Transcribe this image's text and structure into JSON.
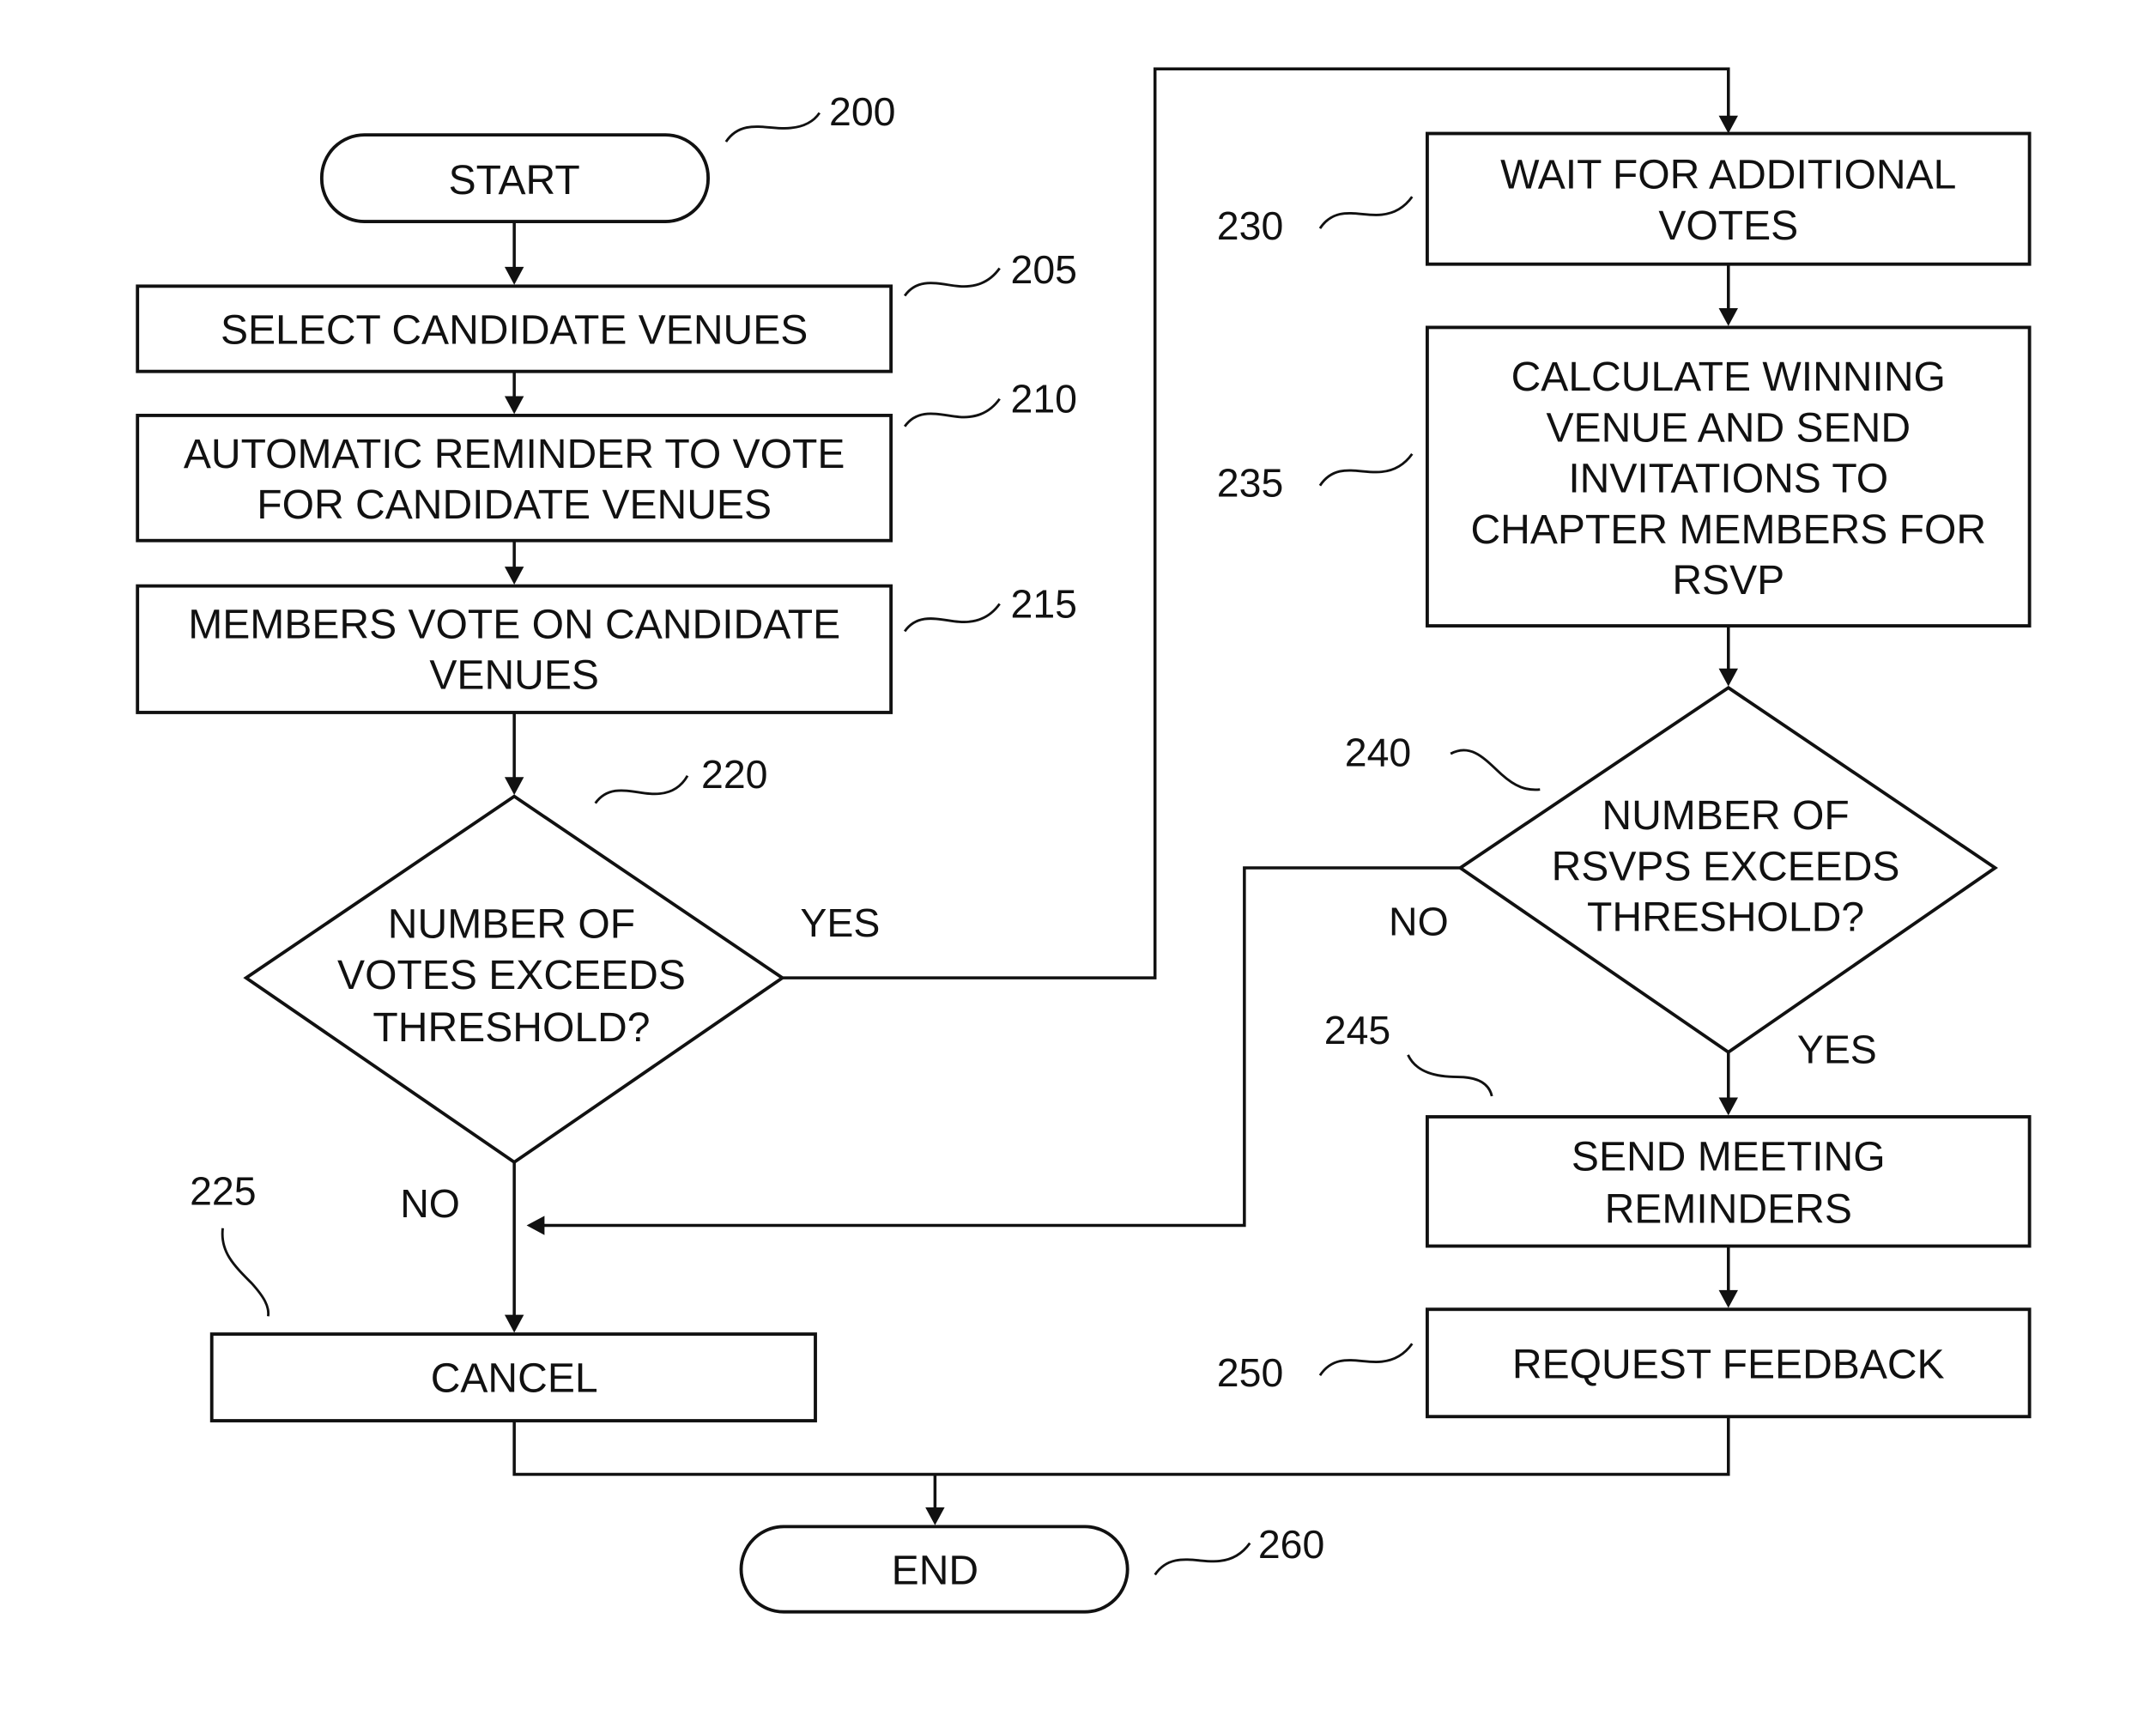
{
  "figure": {
    "figure_ref": "200",
    "nodes": [
      {
        "id": "start",
        "ref": "",
        "type": "terminal",
        "lines": [
          "START"
        ]
      },
      {
        "id": "select-candidate-venues",
        "ref": "205",
        "type": "process",
        "lines": [
          "SELECT CANDIDATE VENUES"
        ]
      },
      {
        "id": "automatic-reminder",
        "ref": "210",
        "type": "process",
        "lines": [
          "AUTOMATIC REMINDER TO VOTE",
          "FOR CANDIDATE VENUES"
        ]
      },
      {
        "id": "members-vote",
        "ref": "215",
        "type": "process",
        "lines": [
          "MEMBERS VOTE ON CANDIDATE",
          "VENUES"
        ]
      },
      {
        "id": "votes-threshold",
        "ref": "220",
        "type": "decision",
        "lines": [
          "NUMBER OF",
          "VOTES EXCEEDS",
          "THRESHOLD?"
        ]
      },
      {
        "id": "cancel",
        "ref": "225",
        "type": "process",
        "lines": [
          "CANCEL"
        ]
      },
      {
        "id": "wait-additional-votes",
        "ref": "230",
        "type": "process",
        "lines": [
          "WAIT FOR ADDITIONAL",
          "VOTES"
        ]
      },
      {
        "id": "calculate-winning-venue",
        "ref": "235",
        "type": "process",
        "lines": [
          "CALCULATE WINNING",
          "VENUE AND SEND",
          "INVITATIONS TO",
          "CHAPTER MEMBERS FOR",
          "RSVP"
        ]
      },
      {
        "id": "rsvps-threshold",
        "ref": "240",
        "type": "decision",
        "lines": [
          "NUMBER OF",
          "RSVPS EXCEEDS",
          "THRESHOLD?"
        ]
      },
      {
        "id": "send-meeting-reminders",
        "ref": "245",
        "type": "process",
        "lines": [
          "SEND MEETING",
          "REMINDERS"
        ]
      },
      {
        "id": "request-feedback",
        "ref": "250",
        "type": "process",
        "lines": [
          "REQUEST FEEDBACK"
        ]
      },
      {
        "id": "end",
        "ref": "260",
        "type": "terminal",
        "lines": [
          "END"
        ]
      }
    ],
    "edge_labels": {
      "votes_yes": "YES",
      "votes_no": "NO",
      "rsvps_no": "NO",
      "rsvps_yes": "YES"
    },
    "edges": [
      {
        "from": "start",
        "to": "select-candidate-venues",
        "label": ""
      },
      {
        "from": "select-candidate-venues",
        "to": "automatic-reminder",
        "label": ""
      },
      {
        "from": "automatic-reminder",
        "to": "members-vote",
        "label": ""
      },
      {
        "from": "members-vote",
        "to": "votes-threshold",
        "label": ""
      },
      {
        "from": "votes-threshold",
        "to": "wait-additional-votes",
        "label": "YES"
      },
      {
        "from": "votes-threshold",
        "to": "cancel",
        "label": "NO"
      },
      {
        "from": "wait-additional-votes",
        "to": "calculate-winning-venue",
        "label": ""
      },
      {
        "from": "calculate-winning-venue",
        "to": "rsvps-threshold",
        "label": ""
      },
      {
        "from": "rsvps-threshold",
        "to": "cancel",
        "label": "NO"
      },
      {
        "from": "rsvps-threshold",
        "to": "send-meeting-reminders",
        "label": "YES"
      },
      {
        "from": "send-meeting-reminders",
        "to": "request-feedback",
        "label": ""
      },
      {
        "from": "cancel",
        "to": "end",
        "label": ""
      },
      {
        "from": "request-feedback",
        "to": "end",
        "label": ""
      }
    ]
  }
}
